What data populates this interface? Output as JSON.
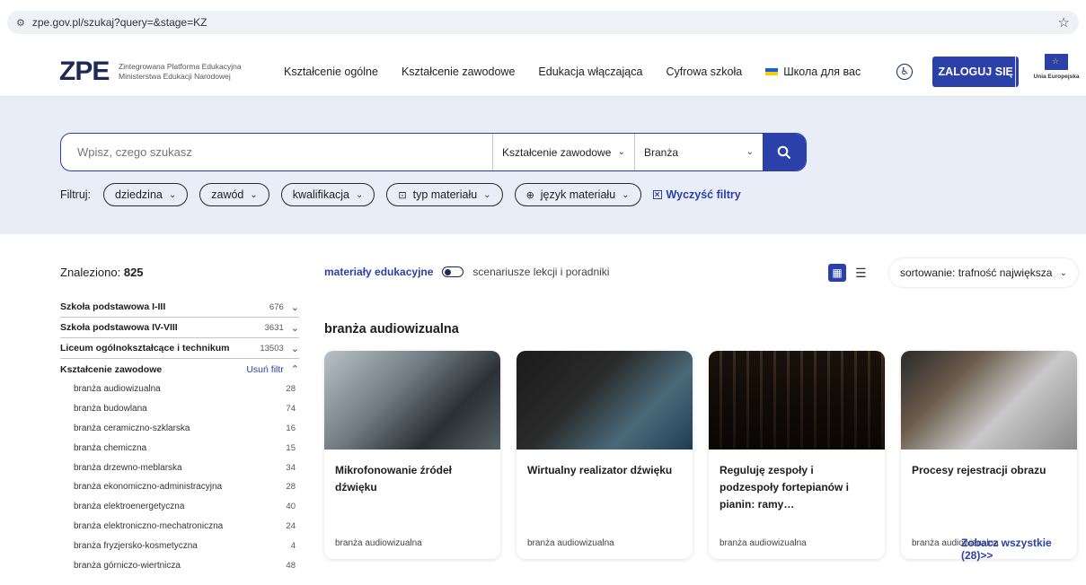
{
  "browser": {
    "url": "zpe.gov.pl/szukaj?query=&stage=KZ"
  },
  "header": {
    "logo": "ZPE",
    "logo_line1": "Zintegrowana Platforma Edukacyjna",
    "logo_line2": "Ministerstwa Edukacji Narodowej",
    "nav": [
      "Kształcenie ogólne",
      "Kształcenie zawodowe",
      "Edukacja włączająca",
      "Cyfrowa szkoła",
      "Школа для вас"
    ],
    "login": "ZALOGUJ SIĘ",
    "eu": "Unia Europejska"
  },
  "search": {
    "placeholder": "Wpisz, czego szukasz",
    "stage": "Kształcenie zawodowe",
    "branch": "Branża"
  },
  "filters": {
    "label": "Filtruj:",
    "chips": [
      "dziedzina",
      "zawód",
      "kwalifikacja",
      "typ materiału",
      "język materiału"
    ],
    "clear": "Wyczyść filtry"
  },
  "results": {
    "found_label": "Znaleziono:",
    "found_count": "825",
    "toggle_on": "materiały edukacyjne",
    "toggle_off": "scenariusze lekcji i poradniki",
    "sort": "sortowanie: trafność największa"
  },
  "sidebar": {
    "stages": [
      {
        "name": "Szkoła podstawowa I-III",
        "count": "676"
      },
      {
        "name": "Szkoła podstawowa IV-VIII",
        "count": "3631"
      },
      {
        "name": "Liceum ogólnokształcące i technikum",
        "count": "13503"
      }
    ],
    "active": {
      "name": "Kształcenie zawodowe",
      "remove": "Usuń filtr"
    },
    "branches": [
      {
        "name": "branża audiowizualna",
        "count": "28"
      },
      {
        "name": "branża budowlana",
        "count": "74"
      },
      {
        "name": "branża ceramiczno-szklarska",
        "count": "16"
      },
      {
        "name": "branża chemiczna",
        "count": "15"
      },
      {
        "name": "branża drzewno-meblarska",
        "count": "34"
      },
      {
        "name": "branża ekonomiczno-administracyjna",
        "count": "28"
      },
      {
        "name": "branża elektroenergetyczna",
        "count": "40"
      },
      {
        "name": "branża elektroniczno-mechatroniczna",
        "count": "24"
      },
      {
        "name": "branża fryzjersko-kosmetyczna",
        "count": "4"
      },
      {
        "name": "branża górniczo-wiertnicza",
        "count": "48"
      }
    ]
  },
  "section": {
    "title": "branża audiowizualna",
    "cards": [
      {
        "title": "Mikrofonowanie źródeł dźwięku",
        "tag": "branża audiowizualna"
      },
      {
        "title": "Wirtualny realizator dźwięku",
        "tag": "branża audiowizualna"
      },
      {
        "title": "Reguluję zespoły i podzespoły fortepianów i pianin: ramy…",
        "tag": "branża audiowizualna"
      },
      {
        "title": "Procesy rejestracji obrazu",
        "tag": "branża audiowizualna"
      }
    ],
    "see_all": "Zobacz wszystkie (28)>>"
  }
}
